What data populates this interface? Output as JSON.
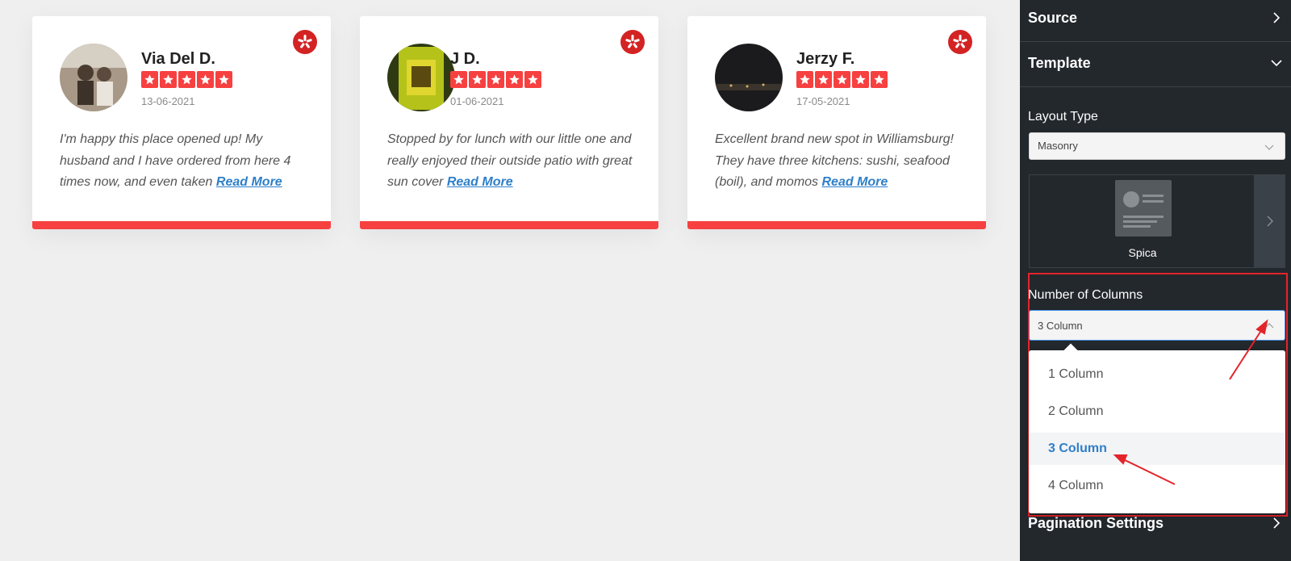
{
  "reviews": [
    {
      "name": "Via Del D.",
      "date": "13-06-2021",
      "text": "I'm happy this place opened up! My husband and I have ordered from here 4 times now, and even taken ",
      "read_more": "Read More",
      "rating": 5
    },
    {
      "name": "J D.",
      "date": "01-06-2021",
      "text": "Stopped by for lunch with our little one and really enjoyed their outside patio with great sun cover ",
      "read_more": "Read More",
      "rating": 5
    },
    {
      "name": "Jerzy F.",
      "date": "17-05-2021",
      "text": "Excellent brand new spot in Williamsburg! They have three kitchens: sushi, seafood (boil), and momos ",
      "read_more": "Read More",
      "rating": 5
    }
  ],
  "sidebar": {
    "source_label": "Source",
    "template_label": "Template",
    "layout_type_label": "Layout Type",
    "layout_type_value": "Masonry",
    "template_name": "Spica",
    "columns_label": "Number of Columns",
    "columns_value": "3 Column",
    "column_options": [
      "1 Column",
      "2 Column",
      "3 Column",
      "4 Column"
    ],
    "selected_option_index": 2,
    "pagination_label": "Pagination Settings"
  },
  "colors": {
    "accent_red": "#f74040",
    "yelp_red": "#d32323",
    "link_blue": "#2e7fc9",
    "sidebar_bg": "#23282d",
    "highlight_red": "#e3242b"
  }
}
